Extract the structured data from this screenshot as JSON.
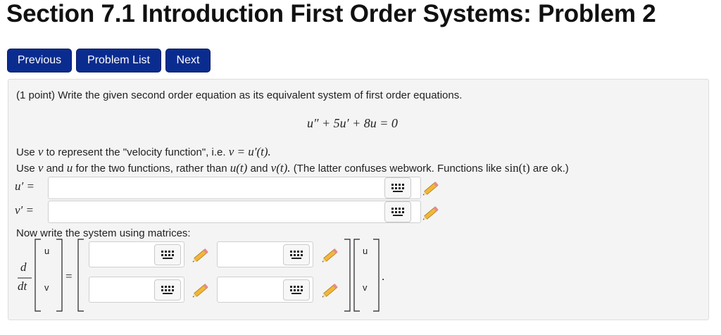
{
  "page": {
    "title": "Section 7.1 Introduction First Order Systems: Problem 2"
  },
  "nav": {
    "previous": "Previous",
    "problem_list": "Problem List",
    "next": "Next"
  },
  "problem": {
    "points": "(1 point) Write the given second order equation as its equivalent system of first order equations.",
    "equation": "u″ + 5u′ + 8u = 0",
    "instr1_a": "Use",
    "instr1_var": "v",
    "instr1_b": "to represent the \"velocity function\", i.e.",
    "instr1_eq": "v = u′(t).",
    "instr2_a": "Use",
    "instr2_v": "v",
    "instr2_and": "and",
    "instr2_u": "u",
    "instr2_b": "for the two functions, rather than",
    "instr2_ut": "u(t)",
    "instr2_and2": "and",
    "instr2_vt": "v(t).",
    "instr2_c": "(The latter confuses webwork. Functions like",
    "instr2_sin": "sin(t)",
    "instr2_d": "are ok.)",
    "uprime_label": "u′ =",
    "vprime_label": "v′ =",
    "uprime_value": "",
    "vprime_value": "",
    "matrix_prompt": "Now write the system using matrices:",
    "deriv_num": "d",
    "deriv_den": "dt",
    "vec_left": [
      "u",
      "v"
    ],
    "vec_right": [
      "u",
      "v"
    ],
    "equals": "=",
    "period": ".",
    "matrix_values": [
      "",
      "",
      "",
      ""
    ]
  },
  "icons": {
    "keyboard": "keyboard-icon",
    "pencil": "pencil-icon"
  },
  "colors": {
    "nav_button": "#0b2c8f",
    "panel_bg": "#f4f4f4"
  }
}
